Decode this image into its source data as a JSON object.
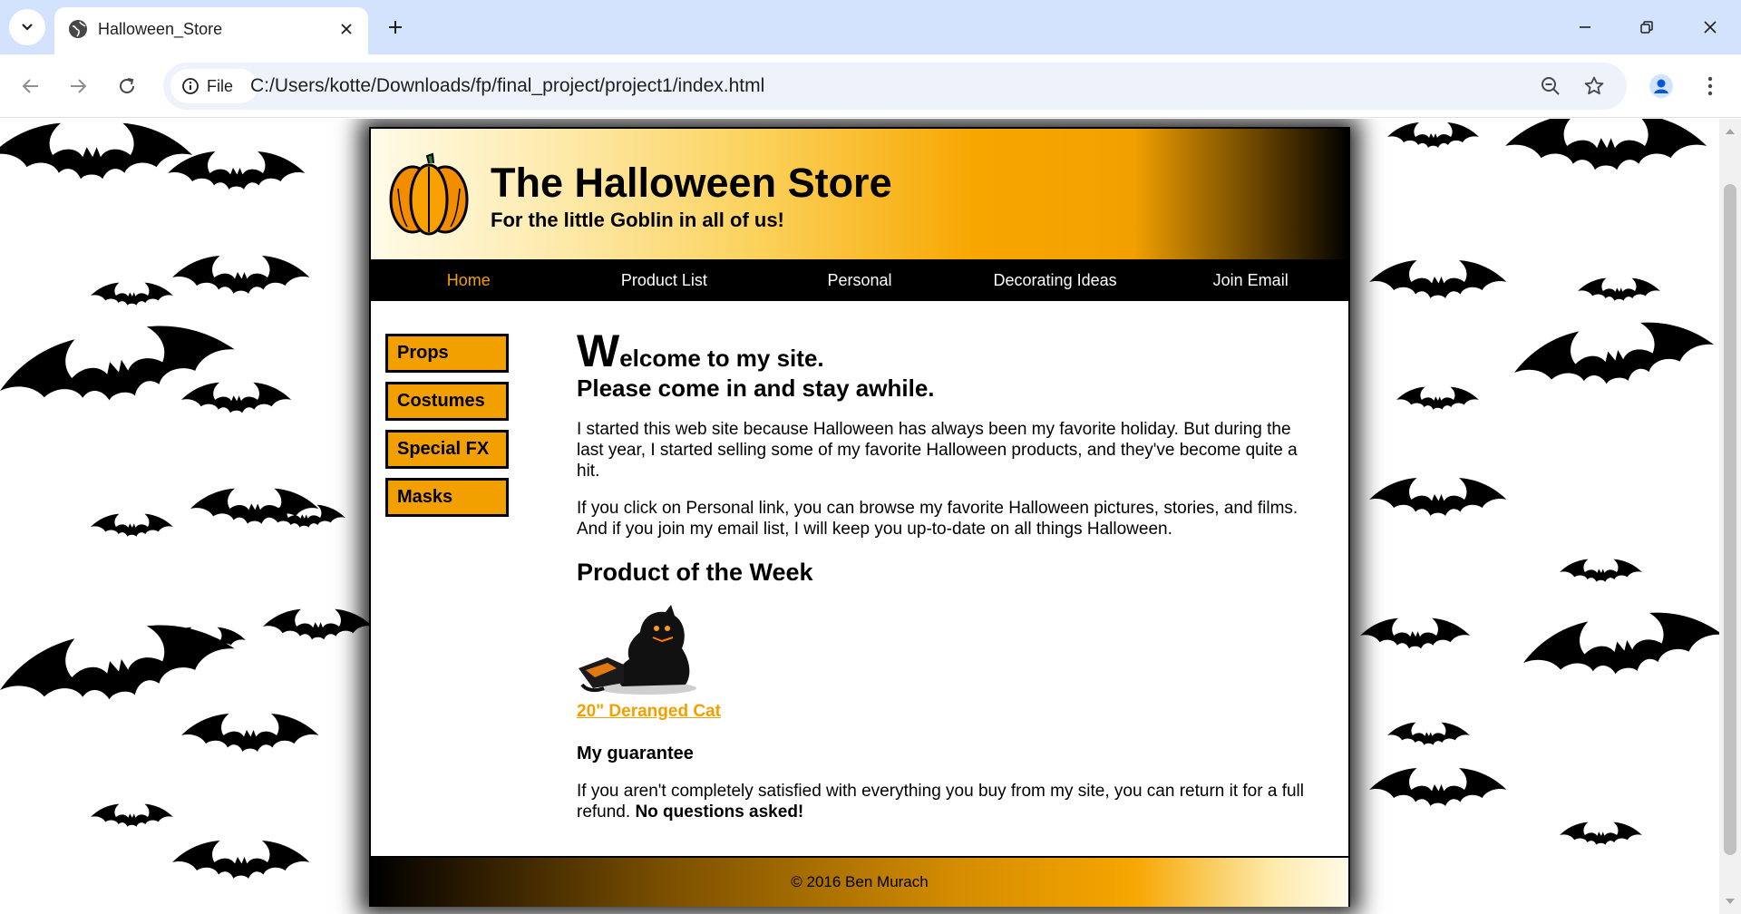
{
  "browser": {
    "tab_title": "Halloween_Store",
    "address_chip": "File",
    "url": "C:/Users/kotte/Downloads/fp/final_project/project1/index.html"
  },
  "site": {
    "title": "The Halloween Store",
    "tagline": "For the little Goblin in all of us!",
    "nav": [
      "Home",
      "Product List",
      "Personal",
      "Decorating Ideas",
      "Join Email"
    ],
    "current_nav": "Home",
    "side_nav": [
      "Props",
      "Costumes",
      "Special FX",
      "Masks"
    ],
    "welcome_cap": "W",
    "welcome_rest": "elcome to my site.",
    "subwelcome": "Please come in and stay awhile.",
    "para1": "I started this web site because Halloween has always been my favorite holiday. But during the last year, I started selling some of my favorite Halloween products, and they've become quite a hit.",
    "para2": "If you click on Personal link, you can browse my favorite Halloween pictures, stories, and films. And if you join my email list, I will keep you up-to-date on all things Halloween.",
    "product_heading": "Product of the Week",
    "product_link": "20\" Deranged Cat",
    "guarantee_heading": "My guarantee",
    "guarantee_text": "If you aren't completely satisfied with everything you buy from my site, you can return it for a full refund.",
    "guarantee_bold": "No questions asked!",
    "footer": "© 2016 Ben Murach"
  },
  "colors": {
    "accent": "#f2a000",
    "tabbar": "#d3e3fd",
    "nav_bg": "#000000"
  }
}
